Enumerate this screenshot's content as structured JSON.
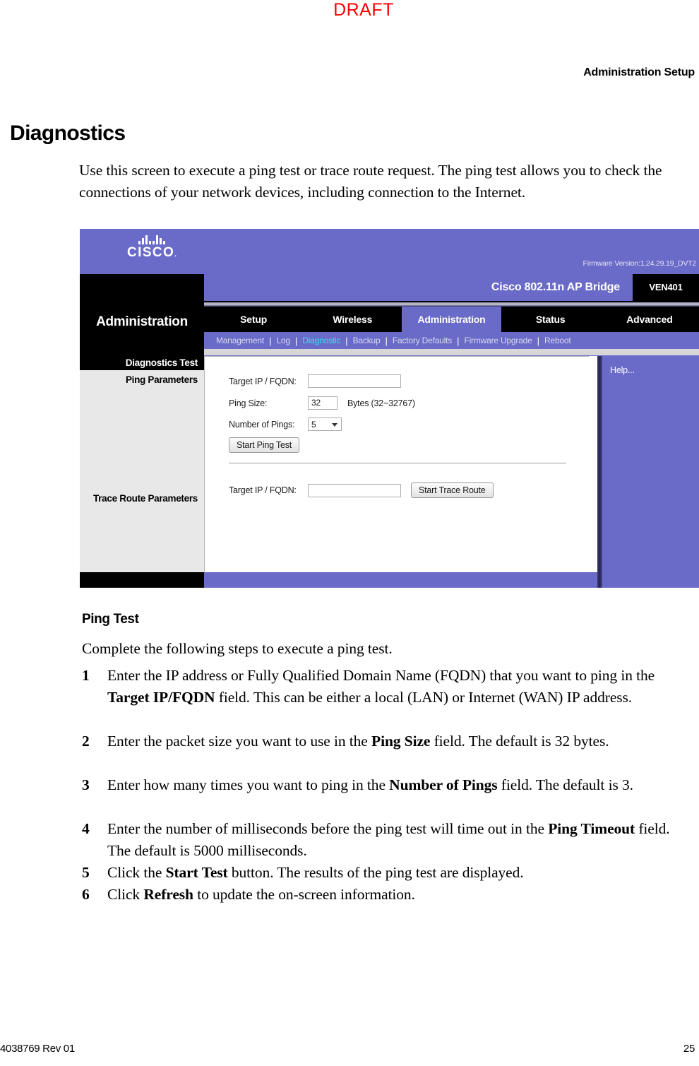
{
  "page": {
    "watermark": "DRAFT",
    "running_head": "Administration Setup",
    "heading": "Diagnostics",
    "intro": "Use this screen to execute a ping test or trace route request. The ping test allows you to check the connections of your network devices, including connection to the Internet.",
    "footer_left": "4038769 Rev 01",
    "footer_right": "25"
  },
  "screenshot": {
    "brand": {
      "logo_word": "CISCO",
      "logo_mark": "cisco-bars-logo",
      "firmware": "Firmware Version:1.24.29.19_DVT2"
    },
    "model": {
      "name": "Cisco 802.11n AP Bridge",
      "badge": "VEN401"
    },
    "section_title": "Administration",
    "tabs": [
      {
        "label": "Setup",
        "active": false
      },
      {
        "label": "Wireless",
        "active": false
      },
      {
        "label": "Administration",
        "active": true
      },
      {
        "label": "Status",
        "active": false
      },
      {
        "label": "Advanced",
        "active": false
      }
    ],
    "subnav": [
      {
        "label": "Management",
        "selected": false
      },
      {
        "label": "Log",
        "selected": false
      },
      {
        "label": "Diagnostic",
        "selected": true
      },
      {
        "label": "Backup",
        "selected": false
      },
      {
        "label": "Factory Defaults",
        "selected": false
      },
      {
        "label": "Firmware Upgrade",
        "selected": false
      },
      {
        "label": "Reboot",
        "selected": false
      }
    ],
    "left_panel": {
      "title": "Diagnostics Test",
      "ping_group": "Ping Parameters",
      "trace_group": "Trace Route Parameters"
    },
    "ping": {
      "target_label": "Target IP / FQDN:",
      "target_value": "",
      "size_label": "Ping Size:",
      "size_value": "32",
      "size_units": "Bytes (32~32767)",
      "count_label": "Number of Pings:",
      "count_value": "5",
      "button": "Start Ping Test"
    },
    "trace": {
      "target_label": "Target IP / FQDN:",
      "target_value": "",
      "button": "Start Trace Route"
    },
    "help": {
      "label": "Help..."
    }
  },
  "ping_test": {
    "heading": "Ping Test",
    "lead": "Complete the following steps to execute a ping test.",
    "steps": [
      {
        "num": "1",
        "html": "Enter the IP address or Fully Qualified Domain Name (FQDN) that you want to ping in the <b>Target IP/FQDN</b> field. This can be either a local (LAN) or Internet (WAN) IP address."
      },
      {
        "num": "2",
        "html": "Enter the packet size you want to use in the <b>Ping Size</b> field. The default is 32 bytes."
      },
      {
        "num": "3",
        "html": "Enter how many times you want to ping in the <b>Number of Pings</b> field. The default is 3."
      },
      {
        "num": "4",
        "html": "Enter the number of milliseconds before the ping test will time out in the <b>Ping Timeout</b> field. The default is 5000 milliseconds."
      },
      {
        "num": "5",
        "html": "Click the <b>Start Test</b> button. The results of the ping test are displayed."
      },
      {
        "num": "6",
        "html": "Click <b>Refresh</b> to update the on-screen information."
      }
    ]
  },
  "colors": {
    "purple": "#6a6ac8",
    "draft_red": "#ff0000",
    "selected_link": "#39e0e8",
    "panel_grey": "#e8e8e8"
  }
}
